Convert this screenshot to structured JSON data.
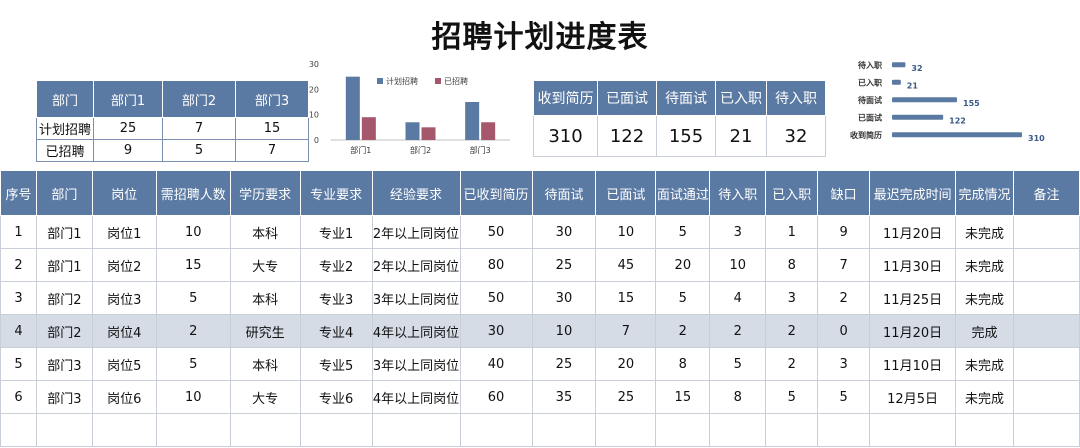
{
  "title": "招聘计划进度表",
  "summary": {
    "headers": [
      "部门",
      "部门1",
      "部门2",
      "部门3"
    ],
    "rows": [
      {
        "label": "计划招聘",
        "values": [
          "25",
          "7",
          "15"
        ]
      },
      {
        "label": "已招聘",
        "values": [
          "9",
          "5",
          "7"
        ]
      }
    ]
  },
  "stats": {
    "headers": [
      "收到简历",
      "已面试",
      "待面试",
      "已入职",
      "待入职"
    ],
    "values": [
      "310",
      "122",
      "155",
      "21",
      "32"
    ]
  },
  "chart_data": [
    {
      "type": "bar",
      "categories": [
        "部门1",
        "部门2",
        "部门3"
      ],
      "series": [
        {
          "name": "计划招聘",
          "values": [
            25,
            7,
            15
          ],
          "color": "#5b7aa3"
        },
        {
          "name": "已招聘",
          "values": [
            9,
            5,
            7
          ],
          "color": "#a5576c"
        }
      ],
      "ylim": [
        0,
        30
      ],
      "yticks": [
        "0",
        "10",
        "20",
        "30"
      ],
      "legend": "top"
    },
    {
      "type": "bar",
      "orientation": "horizontal",
      "categories": [
        "待入职",
        "已入职",
        "待面试",
        "已面试",
        "收到简历"
      ],
      "values": [
        32,
        21,
        155,
        122,
        310
      ],
      "color": "#5b7aa3"
    }
  ],
  "main": {
    "headers": [
      "序号",
      "部门",
      "岗位",
      "需招聘人数",
      "学历要求",
      "专业要求",
      "经验要求",
      "已收到简历",
      "待面试",
      "已面试",
      "面试通过",
      "待入职",
      "已入职",
      "缺口",
      "最迟完成时间",
      "完成情况",
      "备注"
    ],
    "rows": [
      [
        "1",
        "部门1",
        "岗位1",
        "10",
        "本科",
        "专业1",
        "2年以上同岗位",
        "50",
        "30",
        "10",
        "5",
        "3",
        "1",
        "9",
        "11月20日",
        "未完成",
        ""
      ],
      [
        "2",
        "部门1",
        "岗位2",
        "15",
        "大专",
        "专业2",
        "2年以上同岗位",
        "80",
        "25",
        "45",
        "20",
        "10",
        "8",
        "7",
        "11月30日",
        "未完成",
        ""
      ],
      [
        "3",
        "部门2",
        "岗位3",
        "5",
        "本科",
        "专业3",
        "3年以上同岗位",
        "50",
        "30",
        "15",
        "5",
        "4",
        "3",
        "2",
        "11月25日",
        "未完成",
        ""
      ],
      [
        "4",
        "部门2",
        "岗位4",
        "2",
        "研究生",
        "专业4",
        "4年以上同岗位",
        "30",
        "10",
        "7",
        "2",
        "2",
        "2",
        "0",
        "11月20日",
        "完成",
        ""
      ],
      [
        "5",
        "部门3",
        "岗位5",
        "5",
        "本科",
        "专业5",
        "3年以上同岗位",
        "40",
        "25",
        "20",
        "8",
        "5",
        "2",
        "3",
        "11月10日",
        "未完成",
        ""
      ],
      [
        "6",
        "部门3",
        "岗位6",
        "10",
        "大专",
        "专业6",
        "4年以上同岗位",
        "60",
        "35",
        "25",
        "15",
        "8",
        "5",
        "5",
        "12月5日",
        "未完成",
        ""
      ],
      [
        "",
        "",
        "",
        "",
        "",
        "",
        "",
        "",
        "",
        "",
        "",
        "",
        "",
        "",
        "",
        "",
        ""
      ]
    ],
    "highlight_row": 3
  }
}
